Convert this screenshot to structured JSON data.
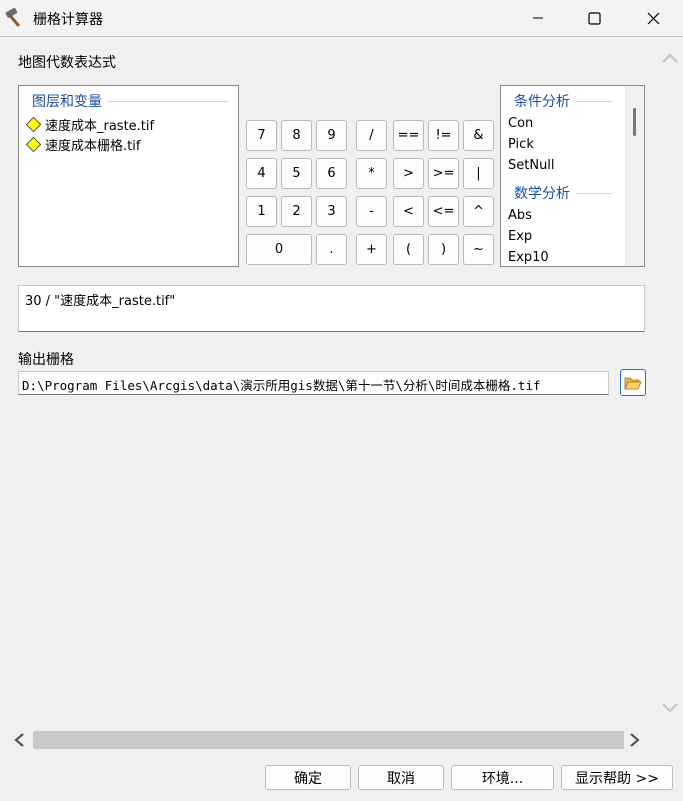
{
  "window": {
    "title": "栅格计算器",
    "icon": "hammer-icon"
  },
  "expression_section": {
    "label": "地图代数表达式"
  },
  "layers_panel": {
    "group_title": "图层和变量",
    "items": [
      {
        "label": "速度成本_raste.tif",
        "icon": "raster-diamond-icon"
      },
      {
        "label": "速度成本栅格.tif",
        "icon": "raster-diamond-icon"
      }
    ]
  },
  "calculator": {
    "keys": {
      "k7": "7",
      "k8": "8",
      "k9": "9",
      "div": "/",
      "eq": "==",
      "neq": "!=",
      "and": "&",
      "k4": "4",
      "k5": "5",
      "k6": "6",
      "mul": "*",
      "gt": ">",
      "gte": ">=",
      "or": "|",
      "k1": "1",
      "k2": "2",
      "k3": "3",
      "sub": "-",
      "lt": "<",
      "lte": "<=",
      "xor": "^",
      "k0": "0",
      "dot": ".",
      "add": "+",
      "lparen": "(",
      "rparen": ")",
      "not": "~"
    }
  },
  "tools_panel": {
    "groups": [
      {
        "title": "条件分析",
        "items": [
          "Con",
          "Pick",
          "SetNull"
        ]
      },
      {
        "title": "数学分析",
        "items": [
          "Abs",
          "Exp",
          "Exp10"
        ]
      }
    ]
  },
  "expression": {
    "value": "30 / \"速度成本_raste.tif\""
  },
  "output": {
    "label": "输出栅格",
    "value": "D:\\Program Files\\Arcgis\\data\\演示所用gis数据\\第十一节\\分析\\时间成本栅格.tif",
    "browse_icon": "folder-open-icon"
  },
  "footer": {
    "ok": "确定",
    "cancel": "取消",
    "environments": "环境...",
    "show_help": "显示帮助 >>"
  },
  "colors": {
    "group_title": "#1d4fa5",
    "diamond_fill": "#ffff00",
    "browse_border": "#1d6fd1"
  }
}
